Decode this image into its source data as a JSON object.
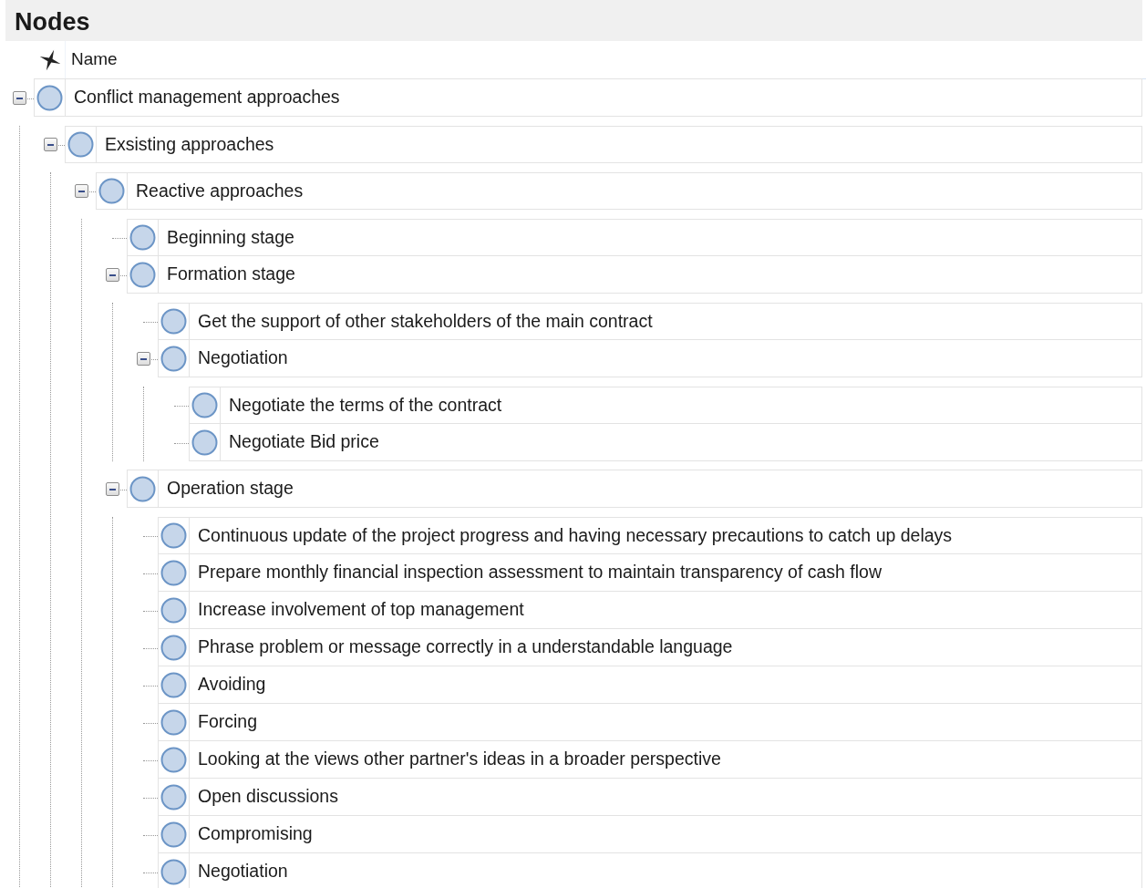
{
  "panel": {
    "title": "Nodes"
  },
  "columns": [
    {
      "label": "Name"
    }
  ],
  "nodes": [
    {
      "label": "Conflict management approaches",
      "expanded": true,
      "children": [
        {
          "label": "Exsisting approaches",
          "expanded": true,
          "children": [
            {
              "label": "Reactive approaches",
              "expanded": true,
              "children": [
                {
                  "label": "Beginning stage"
                },
                {
                  "label": "Formation stage",
                  "expanded": true,
                  "children": [
                    {
                      "label": "Get the support of other stakeholders of the main contract"
                    },
                    {
                      "label": "Negotiation",
                      "expanded": true,
                      "children": [
                        {
                          "label": "Negotiate the terms of the contract"
                        },
                        {
                          "label": "Negotiate Bid price"
                        }
                      ]
                    }
                  ]
                },
                {
                  "label": "Operation stage",
                  "expanded": true,
                  "children": [
                    {
                      "label": "Continuous update of the project progress and having necessary precautions to catch up delays"
                    },
                    {
                      "label": "Prepare monthly financial inspection assessment to maintain transparency of cash flow"
                    },
                    {
                      "label": "Increase involvement of top management"
                    },
                    {
                      "label": "Phrase problem or message correctly in a understandable language"
                    },
                    {
                      "label": "Avoiding"
                    },
                    {
                      "label": "Forcing"
                    },
                    {
                      "label": "Looking at the views other partner's ideas in a broader perspective"
                    },
                    {
                      "label": "Open discussions"
                    },
                    {
                      "label": "Compromising"
                    },
                    {
                      "label": "Negotiation"
                    }
                  ]
                }
              ]
            }
          ]
        }
      ]
    }
  ]
}
